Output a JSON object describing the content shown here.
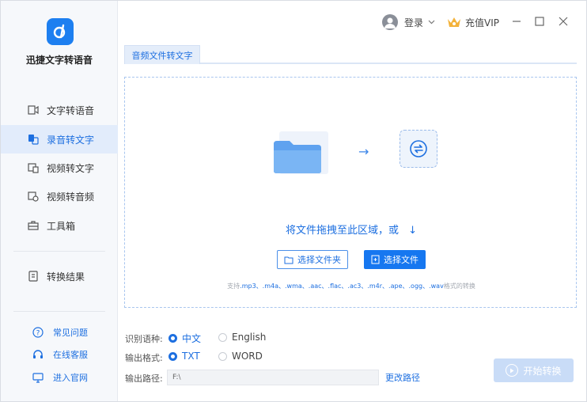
{
  "app": {
    "name": "迅捷文字转语音",
    "accent_color": "#1d6fe0"
  },
  "sidebar": {
    "items": [
      {
        "label": "文字转语音",
        "icon": "text-to-speech-icon",
        "active": false
      },
      {
        "label": "录音转文字",
        "icon": "audio-to-text-icon",
        "active": true
      },
      {
        "label": "视频转文字",
        "icon": "video-to-text-icon",
        "active": false
      },
      {
        "label": "视频转音频",
        "icon": "video-to-audio-icon",
        "active": false
      },
      {
        "label": "工具箱",
        "icon": "toolbox-icon",
        "active": false
      }
    ],
    "result": {
      "label": "转换结果",
      "icon": "result-document-icon"
    },
    "bottom_links": [
      {
        "label": "常见问题",
        "icon": "question-circle-icon"
      },
      {
        "label": "在线客服",
        "icon": "headset-icon"
      },
      {
        "label": "进入官网",
        "icon": "monitor-icon"
      }
    ]
  },
  "header": {
    "login_label": "登录",
    "vip_label": "充值VIP"
  },
  "tab": {
    "label": "音频文件转文字"
  },
  "dropzone": {
    "prompt": "将文件拖拽至此区域，或",
    "select_folder_label": "选择文件夹",
    "select_file_label": "选择文件",
    "support_prefix": "支持",
    "support_formats": ".mp3、.m4a、.wma、.aac、.flac、.ac3、.m4r、.ape、.ogg、.wav",
    "support_suffix": "格式的转换"
  },
  "options": {
    "language_label": "识别语种:",
    "language_options": [
      "中文",
      "English"
    ],
    "language_selected": "中文",
    "format_label": "输出格式:",
    "format_options": [
      "TXT",
      "WORD"
    ],
    "format_selected": "TXT",
    "path_label": "输出路径:",
    "path_value": "F:\\",
    "change_path_label": "更改路径",
    "start_label": "开始转换"
  }
}
